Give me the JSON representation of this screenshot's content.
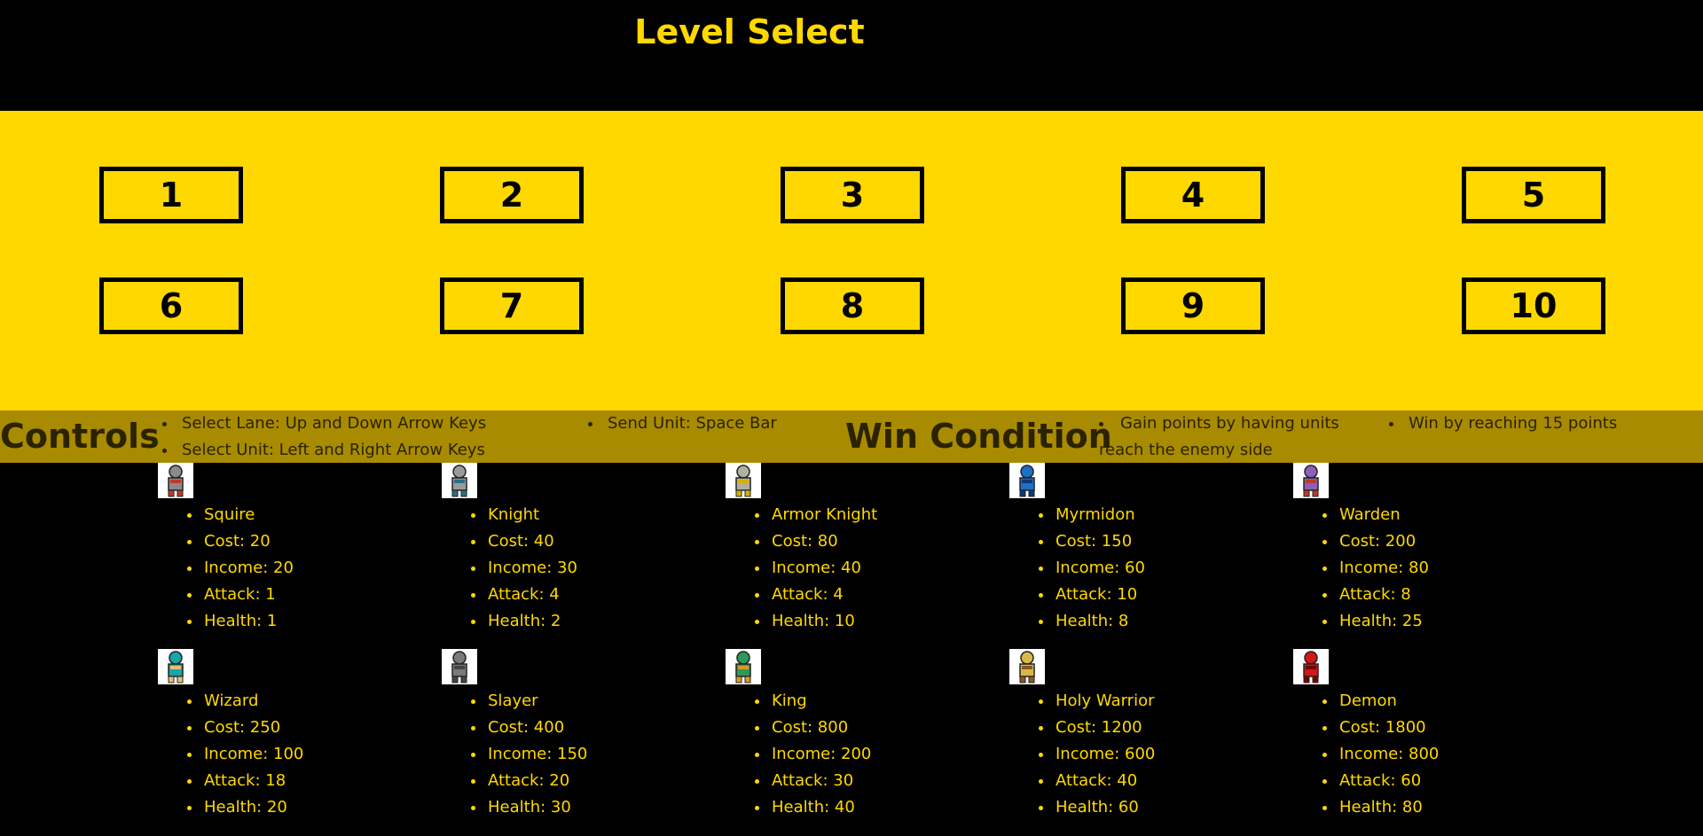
{
  "page_title": "Level Select",
  "levels": [
    "1",
    "2",
    "3",
    "4",
    "5",
    "6",
    "7",
    "8",
    "9",
    "10"
  ],
  "controls": {
    "heading": "Controls",
    "items_col1": [
      "Select Lane: Up and Down Arrow Keys",
      "Select Unit: Left and Right Arrow Keys"
    ],
    "items_col2": [
      "Send Unit: Space Bar"
    ]
  },
  "win_condition": {
    "heading": "Win Condition",
    "item1": "Gain points by having units reach the enemy side",
    "item2": "Win by reaching 15 points"
  },
  "units": [
    {
      "name": "Squire",
      "cost": "Cost: 20",
      "income": "Income: 20",
      "attack": "Attack: 1",
      "health": "Health: 1",
      "sprite": "squire-sprite",
      "color": "#8a8a8a",
      "accent": "#c0392b"
    },
    {
      "name": "Knight",
      "cost": "Cost: 40",
      "income": "Income: 30",
      "attack": "Attack: 4",
      "health": "Health: 2",
      "sprite": "knight-sprite",
      "color": "#9a9a9a",
      "accent": "#2c6e8a"
    },
    {
      "name": "Armor Knight",
      "cost": "Cost: 80",
      "income": "Income: 40",
      "attack": "Attack: 4",
      "health": "Health: 10",
      "sprite": "armor-knight-sprite",
      "color": "#b0b0a0",
      "accent": "#d4b000"
    },
    {
      "name": "Myrmidon",
      "cost": "Cost: 150",
      "income": "Income: 60",
      "attack": "Attack: 10",
      "health": "Health: 8",
      "sprite": "myrmidon-sprite",
      "color": "#1e6fc9",
      "accent": "#0d3b78"
    },
    {
      "name": "Warden",
      "cost": "Cost: 200",
      "income": "Income: 80",
      "attack": "Attack: 8",
      "health": "Health: 25",
      "sprite": "warden-sprite",
      "color": "#8e5fb8",
      "accent": "#c0392b"
    },
    {
      "name": "Wizard",
      "cost": "Cost: 250",
      "income": "Income: 100",
      "attack": "Attack: 18",
      "health": "Health: 20",
      "sprite": "wizard-sprite",
      "color": "#1aa6a6",
      "accent": "#e0c080"
    },
    {
      "name": "Slayer",
      "cost": "Cost: 400",
      "income": "Income: 150",
      "attack": "Attack: 20",
      "health": "Health: 30",
      "sprite": "slayer-sprite",
      "color": "#7a7a7a",
      "accent": "#444444"
    },
    {
      "name": "King",
      "cost": "Cost: 800",
      "income": "Income: 200",
      "attack": "Attack: 30",
      "health": "Health: 40",
      "sprite": "king-sprite",
      "color": "#2e9a5a",
      "accent": "#d99a2b"
    },
    {
      "name": "Holy Warrior",
      "cost": "Cost: 1200",
      "income": "Income: 600",
      "attack": "Attack: 40",
      "health": "Health: 60",
      "sprite": "holy-warrior-sprite",
      "color": "#d9b84a",
      "accent": "#8a5a1a"
    },
    {
      "name": "Demon",
      "cost": "Cost: 1800",
      "income": "Income: 800",
      "attack": "Attack: 60",
      "health": "Health: 80",
      "sprite": "demon-sprite",
      "color": "#d01818",
      "accent": "#7a0000"
    }
  ],
  "colors": {
    "accent": "#FFD800",
    "background": "#000000",
    "info_bar": "#A88B00"
  }
}
